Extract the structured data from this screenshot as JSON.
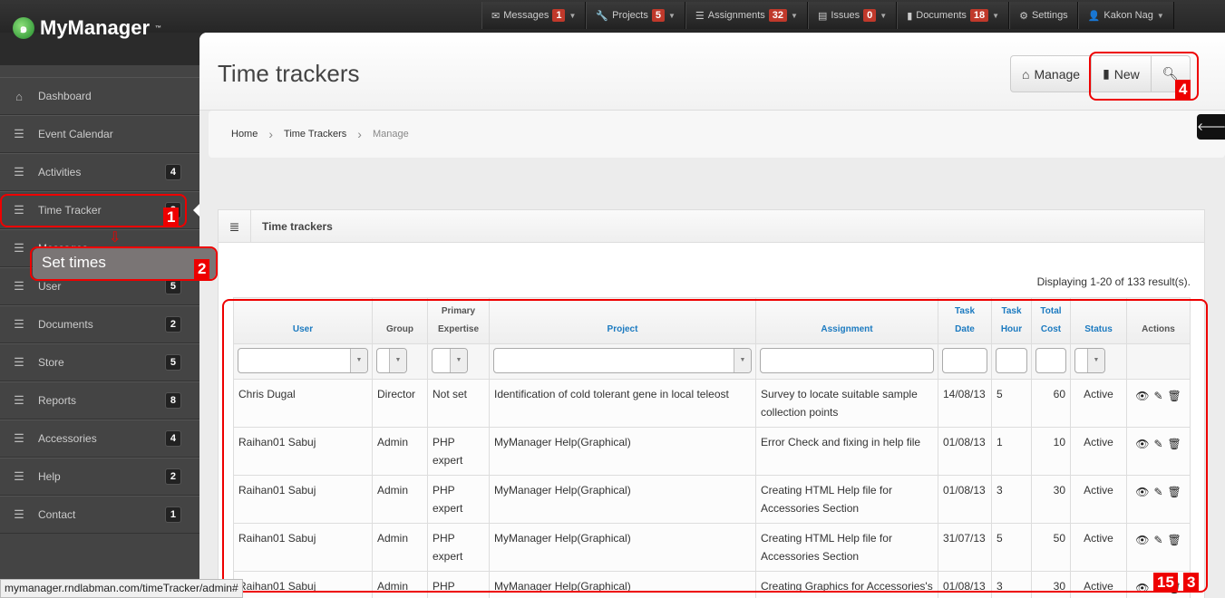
{
  "app": {
    "name": "MyManager",
    "tm": "™"
  },
  "topnav": [
    {
      "label": "Messages",
      "icon": "envelope-icon",
      "glyph": "✉",
      "badge": "1",
      "caret": true
    },
    {
      "label": "Projects",
      "icon": "wrench-icon",
      "glyph": "🔧",
      "badge": "5",
      "caret": true
    },
    {
      "label": "Assignments",
      "icon": "list-icon",
      "glyph": "☰",
      "badge": "32",
      "caret": true
    },
    {
      "label": "Issues",
      "icon": "document-list-icon",
      "glyph": "▤",
      "badge": "0",
      "caret": true
    },
    {
      "label": "Documents",
      "icon": "book-icon",
      "glyph": "▮",
      "badge": "18",
      "caret": true
    },
    {
      "label": "Settings",
      "icon": "gear-icon",
      "glyph": "⚙",
      "badge": null,
      "caret": false
    },
    {
      "label": "Kakon Nag",
      "icon": "user-icon",
      "glyph": "👤",
      "badge": null,
      "caret": true
    }
  ],
  "sidebar": [
    {
      "label": "Dashboard",
      "icon": "home-icon",
      "glyph": "⌂",
      "count": null
    },
    {
      "label": "Event Calendar",
      "icon": "list-icon",
      "glyph": "☰",
      "count": null
    },
    {
      "label": "Activities",
      "icon": "list-icon",
      "glyph": "☰",
      "count": "4"
    },
    {
      "label": "Time Tracker",
      "icon": "list-icon",
      "glyph": "☰",
      "count": "2"
    },
    {
      "label": "Messages",
      "icon": "list-icon",
      "glyph": "☰",
      "count": null
    },
    {
      "label": "User",
      "icon": "list-icon",
      "glyph": "☰",
      "count": "5"
    },
    {
      "label": "Documents",
      "icon": "list-icon",
      "glyph": "☰",
      "count": "2"
    },
    {
      "label": "Store",
      "icon": "list-icon",
      "glyph": "☰",
      "count": "5"
    },
    {
      "label": "Reports",
      "icon": "list-icon",
      "glyph": "☰",
      "count": "8"
    },
    {
      "label": "Accessories",
      "icon": "list-icon",
      "glyph": "☰",
      "count": "4"
    },
    {
      "label": "Help",
      "icon": "list-icon",
      "glyph": "☰",
      "count": "2"
    },
    {
      "label": "Contact",
      "icon": "list-icon",
      "glyph": "☰",
      "count": "1"
    }
  ],
  "popup": {
    "label": "Set times"
  },
  "page": {
    "title": "Time trackers",
    "buttons": {
      "manage": "Manage",
      "new": "New"
    }
  },
  "breadcrumb": [
    "Home",
    "Time Trackers",
    "Manage"
  ],
  "panel": {
    "title": "Time trackers",
    "summary": "Displaying 1-20 of 133 result(s)."
  },
  "table": {
    "headers": [
      [
        "User"
      ],
      [
        "Group"
      ],
      [
        "Primary",
        "Expertise"
      ],
      [
        "Project"
      ],
      [
        "Assignment"
      ],
      [
        "Task",
        "Date"
      ],
      [
        "Task",
        "Hour"
      ],
      [
        "Total",
        "Cost"
      ],
      [
        "Status"
      ],
      [
        "Actions"
      ]
    ],
    "rows": [
      [
        "Chris Dugal",
        "Director",
        "Not set",
        "Identification of cold tolerant gene in local teleost",
        "Survey to locate suitable sample collection points",
        "14/08/13",
        "5",
        "60",
        "Active"
      ],
      [
        "Raihan01 Sabuj",
        "Admin",
        "PHP expert",
        "MyManager Help(Graphical)",
        "Error Check and fixing in help file",
        "01/08/13",
        "1",
        "10",
        "Active"
      ],
      [
        "Raihan01 Sabuj",
        "Admin",
        "PHP expert",
        "MyManager Help(Graphical)",
        "Creating HTML Help file for Accessories Section",
        "01/08/13",
        "3",
        "30",
        "Active"
      ],
      [
        "Raihan01 Sabuj",
        "Admin",
        "PHP expert",
        "MyManager Help(Graphical)",
        "Creating HTML Help file for Accessories Section",
        "31/07/13",
        "5",
        "50",
        "Active"
      ],
      [
        "Raihan01 Sabuj",
        "Admin",
        "PHP expert",
        "MyManager Help(Graphical)",
        "Creating Graphics for Accessories's Help File",
        "01/08/13",
        "3",
        "30",
        "Active"
      ]
    ]
  },
  "annotations": [
    "1",
    "2",
    "3",
    "4",
    "15"
  ],
  "statusbar": "mymanager.rndlabman.com/timeTracker/admin#",
  "colors": {
    "accent": "#1b7ac0",
    "badge": "#c0392b",
    "annotation": "#ee0000"
  }
}
